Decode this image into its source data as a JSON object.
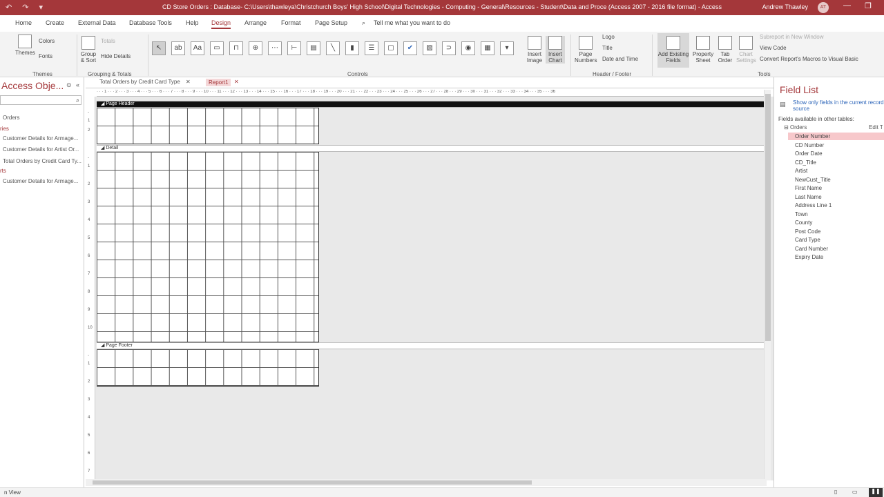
{
  "titlebar": {
    "title": "CD Store Orders : Database- C:\\Users\\thawleya\\Christchurch Boys' High School\\Digital Technologies - Computing - General\\Resources - Student\\Data and Proce (Access 2007 - 2016 file format) - Access",
    "user": "Andrew Thawley",
    "initials": "AT"
  },
  "menu": [
    "Home",
    "Create",
    "External Data",
    "Database Tools",
    "Help",
    "Design",
    "Arrange",
    "Format",
    "Page Setup"
  ],
  "tell_me": "Tell me what you want to do",
  "ribbon": {
    "themes": "Themes",
    "colors": "Colors",
    "fonts": "Fonts",
    "group_sort": "Group & Sort",
    "totals": "Totals",
    "hide_details": "Hide Details",
    "insert_image": "Insert Image",
    "insert_chart": "Insert Chart",
    "page_numbers": "Page Numbers",
    "logo": "Logo",
    "title": "Title",
    "date_time": "Date and Time",
    "add_fields": "Add Existing Fields",
    "property_sheet": "Property Sheet",
    "tab_order": "Tab Order",
    "chart_settings": "Chart Settings",
    "subreport": "Subreport in New Window",
    "view_code": "View Code",
    "convert_macros": "Convert Report's Macros to Visual Basic",
    "groups": {
      "themes": "Themes",
      "grouping": "Grouping & Totals",
      "controls": "Controls",
      "header_footer": "Header / Footer",
      "tools": "Tools"
    }
  },
  "nav": {
    "title": "Access Obje...",
    "sections": [
      "ries",
      "rts"
    ],
    "items": [
      "Orders",
      "Customer Details for Armage...",
      "Customer Details for Artist Or...",
      "Total Orders by Credit Card Ty...",
      "Customer Details for Armage..."
    ]
  },
  "doctabs": [
    "Total Orders by Credit Card Type",
    "Report1"
  ],
  "bands": [
    "Page Header",
    "Detail",
    "Page Footer"
  ],
  "fieldlist": {
    "title": "Field List",
    "show_only": "Show only fields in the current record source",
    "available": "Fields available in other tables:",
    "table": "Orders",
    "edit": "Edit Table",
    "fields": [
      "Order Number",
      "CD Number",
      "Order Date",
      "CD_Title",
      "Artist",
      "NewCust_Title",
      "First Name",
      "Last Name",
      "Address Line 1",
      "Town",
      "County",
      "Post Code",
      "Card Type",
      "Card Number",
      "Expiry Date"
    ]
  },
  "status": "n View"
}
